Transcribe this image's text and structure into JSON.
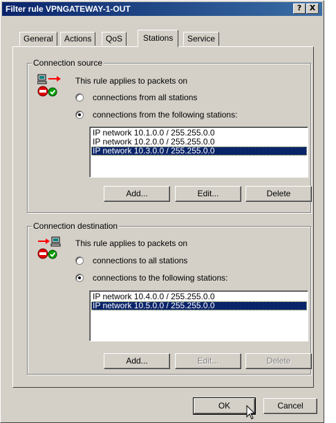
{
  "window": {
    "title": "Filter rule VPNGATEWAY-1-OUT",
    "help_label": "?",
    "close_label": "X"
  },
  "tabs": [
    {
      "label": "General"
    },
    {
      "label": "Actions"
    },
    {
      "label": "QoS"
    },
    {
      "label": "Stations",
      "active": true
    },
    {
      "label": "Service"
    }
  ],
  "source": {
    "group_label": "Connection source",
    "rule_text": "This rule applies to packets on",
    "option_all": "connections from all stations",
    "option_following": "connections from the following stations:",
    "selected_option": "following",
    "items": [
      {
        "label": "IP network 10.1.0.0 / 255.255.0.0",
        "selected": false
      },
      {
        "label": "IP network 10.2.0.0 / 255.255.0.0",
        "selected": false
      },
      {
        "label": "IP network 10.3.0.0 / 255.255.0.0",
        "selected": true
      }
    ],
    "add_label": "Add...",
    "edit_label": "Edit...",
    "delete_label": "Delete"
  },
  "destination": {
    "group_label": "Connection destination",
    "rule_text": "This rule applies to packets on",
    "option_all": "connections to all stations",
    "option_following": "connections to the following stations:",
    "selected_option": "following",
    "items": [
      {
        "label": "IP network 10.4.0.0 / 255.255.0.0",
        "selected": false
      },
      {
        "label": "IP network 10.5.0.0 / 255.255.0.0",
        "selected": true
      }
    ],
    "add_label": "Add...",
    "edit_label": "Edit...",
    "delete_label": "Delete",
    "edit_enabled": false,
    "delete_enabled": false
  },
  "footer": {
    "ok_label": "OK",
    "cancel_label": "Cancel"
  }
}
